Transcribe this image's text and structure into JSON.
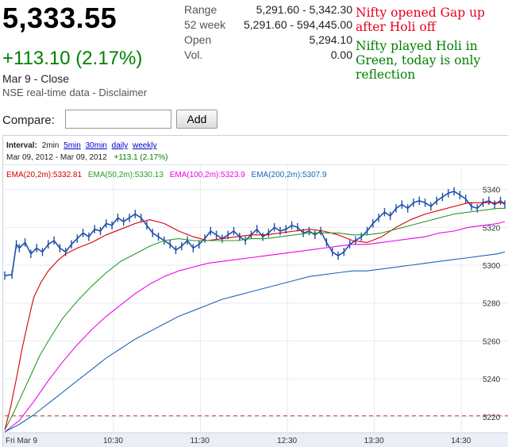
{
  "quote": {
    "price": "5,333.55",
    "change": "+113.10 (2.17%)",
    "date_status": "Mar 9 - Close",
    "source": "NSE real-time data - Disclaimer"
  },
  "stats": [
    {
      "label": "Range",
      "value": "5,291.60 - 5,342.30"
    },
    {
      "label": "52 week",
      "value": "5,291.60 - 594,445.00"
    },
    {
      "label": "Open",
      "value": "5,294.10"
    },
    {
      "label": "Vol.",
      "value": "0.00"
    }
  ],
  "notes": {
    "red": "Nifty opened Gap up after Holi off",
    "green": "Nifty played Holi in Green, today is only reflection",
    "red_color": "#e8001c",
    "green_color": "#008000"
  },
  "compare": {
    "label": "Compare:",
    "input_value": "",
    "add_label": "Add"
  },
  "chart_header": {
    "interval_label": "Interval:",
    "intervals": [
      "2min",
      "5min",
      "30min",
      "daily",
      "weekly"
    ],
    "active_interval": "2min",
    "range_text": "Mar 09, 2012 - Mar 09, 2012",
    "range_change": "+113.1 (2.17%)",
    "ema_labels": [
      {
        "text": "EMA(20,2m):5332.81",
        "color": "#d40000"
      },
      {
        "text": "EMA(50,2m):5330.13",
        "color": "#2a9a2a"
      },
      {
        "text": "EMA(100,2m):5323.9",
        "color": "#ee00ee"
      },
      {
        "text": "EMA(200,2m):5307.9",
        "color": "#1f66b3"
      }
    ]
  },
  "chart_data": {
    "type": "line",
    "title": "",
    "xlabel": "",
    "ylabel": "",
    "x_ticks": [
      "Fri Mar 9",
      "10:30",
      "11:30",
      "12:30",
      "13:30",
      "14:30"
    ],
    "x_tick_minutes": [
      0,
      75,
      135,
      195,
      255,
      315
    ],
    "y_ticks": [
      5220,
      5240,
      5260,
      5280,
      5300,
      5320,
      5340
    ],
    "ylim": [
      5212,
      5344
    ],
    "xlim_minutes": [
      0,
      345
    ],
    "grid": true,
    "reference_line": {
      "value": 5220.5,
      "color": "#cc3333",
      "style": "dashed"
    },
    "series": [
      {
        "name": "",
        "kind": "price",
        "color": "#1f4fa8",
        "x": [
          0,
          5,
          8,
          10,
          14,
          18,
          22,
          26,
          30,
          34,
          38,
          42,
          46,
          50,
          54,
          58,
          62,
          66,
          70,
          74,
          78,
          82,
          86,
          90,
          94,
          98,
          102,
          106,
          110,
          114,
          118,
          122,
          126,
          130,
          134,
          138,
          142,
          146,
          150,
          154,
          158,
          162,
          166,
          170,
          174,
          178,
          182,
          186,
          190,
          194,
          198,
          202,
          206,
          210,
          214,
          218,
          222,
          226,
          230,
          234,
          238,
          242,
          246,
          250,
          254,
          258,
          262,
          266,
          270,
          274,
          278,
          282,
          286,
          290,
          294,
          298,
          302,
          306,
          310,
          314,
          318,
          322,
          326,
          330,
          334,
          338,
          342,
          345
        ],
        "values": [
          5294.5,
          5295,
          5311,
          5309,
          5312,
          5306,
          5309,
          5307,
          5311,
          5313,
          5309,
          5307,
          5311,
          5314,
          5317,
          5315,
          5319,
          5318,
          5322,
          5321,
          5325,
          5323,
          5325,
          5327,
          5325,
          5321,
          5317,
          5315,
          5313,
          5311,
          5308,
          5310,
          5313,
          5309,
          5311,
          5314,
          5318,
          5316,
          5314,
          5316,
          5318,
          5315,
          5313,
          5316,
          5319,
          5315,
          5317,
          5320,
          5318,
          5319,
          5321,
          5320,
          5317,
          5318,
          5316,
          5318,
          5312,
          5307,
          5305,
          5307,
          5311,
          5313,
          5315,
          5318,
          5322,
          5325,
          5328,
          5326,
          5330,
          5332,
          5330,
          5333,
          5334,
          5333,
          5331,
          5334,
          5336,
          5338,
          5339,
          5337,
          5335,
          5331,
          5330,
          5333,
          5334,
          5332,
          5334,
          5332
        ]
      },
      {
        "name": "EMA(20,2m)",
        "color": "#d40000",
        "x": [
          0,
          4,
          8,
          12,
          16,
          20,
          25,
          30,
          36,
          42,
          50,
          60,
          70,
          80,
          90,
          100,
          110,
          120,
          130,
          140,
          150,
          160,
          170,
          180,
          190,
          200,
          210,
          220,
          230,
          240,
          250,
          260,
          270,
          280,
          290,
          300,
          310,
          320,
          330,
          340,
          345
        ],
        "values": [
          5213,
          5225,
          5240,
          5256,
          5270,
          5283,
          5291,
          5297,
          5302,
          5306,
          5309,
          5312,
          5316,
          5319,
          5322,
          5324,
          5322,
          5318,
          5315,
          5313,
          5314,
          5315,
          5316,
          5316,
          5317,
          5318,
          5319,
          5318,
          5316,
          5313,
          5312,
          5315,
          5320,
          5324,
          5327,
          5329,
          5331,
          5333,
          5333,
          5333,
          5333
        ]
      },
      {
        "name": "EMA(50,2m)",
        "color": "#2a9a2a",
        "x": [
          0,
          6,
          12,
          18,
          24,
          30,
          40,
          50,
          60,
          70,
          80,
          90,
          100,
          110,
          120,
          130,
          140,
          150,
          160,
          170,
          180,
          190,
          200,
          210,
          220,
          230,
          240,
          250,
          260,
          270,
          280,
          290,
          300,
          310,
          320,
          330,
          340,
          345
        ],
        "values": [
          5213,
          5222,
          5232,
          5242,
          5252,
          5260,
          5272,
          5281,
          5289,
          5296,
          5302,
          5306,
          5310,
          5313,
          5314,
          5313,
          5313,
          5313,
          5313,
          5314,
          5314,
          5315,
          5316,
          5317,
          5317,
          5317,
          5316,
          5316,
          5317,
          5319,
          5321,
          5323,
          5325,
          5327,
          5328,
          5329,
          5330,
          5330
        ]
      },
      {
        "name": "EMA(100,2m)",
        "color": "#ee00ee",
        "x": [
          0,
          10,
          20,
          30,
          40,
          50,
          60,
          70,
          80,
          90,
          100,
          110,
          120,
          130,
          140,
          150,
          160,
          170,
          180,
          190,
          200,
          210,
          220,
          230,
          240,
          250,
          260,
          270,
          280,
          290,
          300,
          310,
          320,
          330,
          340,
          345
        ],
        "values": [
          5212,
          5218,
          5228,
          5239,
          5249,
          5258,
          5266,
          5273,
          5279,
          5285,
          5290,
          5294,
          5297,
          5299,
          5301,
          5302,
          5303,
          5304,
          5305,
          5306,
          5307,
          5308,
          5309,
          5310,
          5311,
          5311,
          5312,
          5313,
          5314,
          5315,
          5317,
          5318,
          5320,
          5321,
          5322,
          5323
        ]
      },
      {
        "name": "EMA(200,2m)",
        "color": "#1f66b3",
        "x": [
          0,
          10,
          20,
          30,
          40,
          50,
          60,
          70,
          80,
          90,
          100,
          110,
          120,
          130,
          140,
          150,
          160,
          170,
          180,
          190,
          200,
          210,
          220,
          230,
          240,
          250,
          260,
          270,
          280,
          290,
          300,
          310,
          320,
          330,
          340,
          345
        ],
        "values": [
          5212,
          5216,
          5221,
          5227,
          5233,
          5239,
          5245,
          5251,
          5256,
          5261,
          5265,
          5269,
          5273,
          5276,
          5279,
          5282,
          5284,
          5286,
          5288,
          5290,
          5292,
          5294,
          5295,
          5296,
          5297,
          5297,
          5298,
          5299,
          5300,
          5301,
          5302,
          5303,
          5304,
          5305,
          5306,
          5307
        ]
      }
    ]
  }
}
